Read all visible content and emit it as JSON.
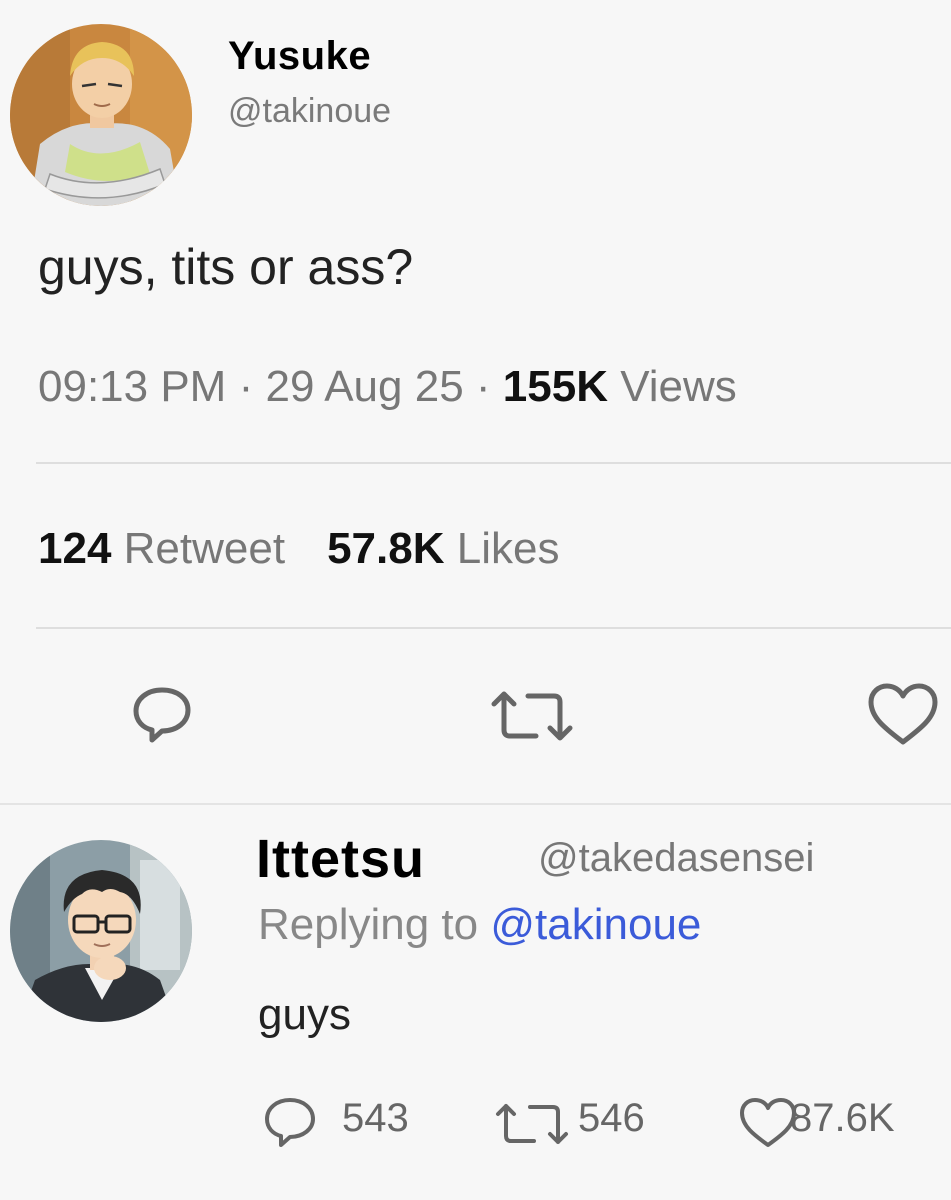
{
  "main_tweet": {
    "author_name": "Yusuke",
    "author_handle": "@takinoue",
    "text": "guys, tits or ass?",
    "time": "09:13 PM",
    "separator": "·",
    "date": "29 Aug 25",
    "views_count": "155K",
    "views_label": "Views",
    "retweet_count": "124",
    "retweet_label": "Retweet",
    "likes_count": "57.8K",
    "likes_label": "Likes",
    "actions": [
      {
        "icon": "reply-icon"
      },
      {
        "icon": "retweet-icon"
      },
      {
        "icon": "heart-icon"
      }
    ]
  },
  "reply": {
    "author_name": "Ittetsu",
    "author_handle": "@takedasensei",
    "replying_prefix": "Replying to",
    "replying_to": "@takinoue",
    "text": "guys",
    "reply_count": "543",
    "retweet_count": "546",
    "like_count": "87.6K"
  },
  "colors": {
    "background": "#f7f7f7",
    "mention": "#3b5bd9",
    "muted": "#777777"
  }
}
